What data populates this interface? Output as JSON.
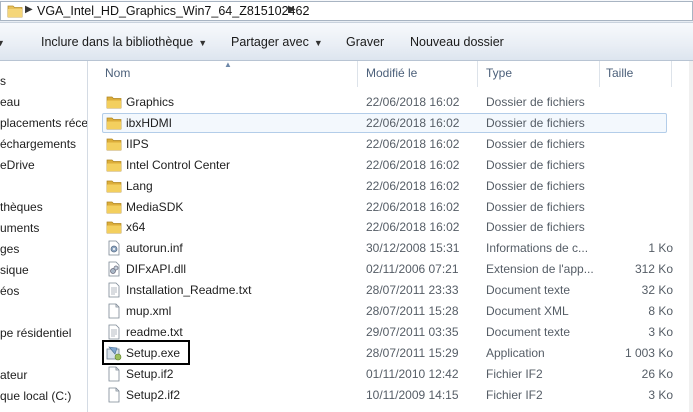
{
  "address": {
    "path_label": "VGA_Intel_HD_Graphics_Win7_64_Z815102462"
  },
  "toolbar": {
    "library_label": "Inclure dans la bibliothèque",
    "share_label": "Partager avec",
    "burn_label": "Graver",
    "new_folder_label": "Nouveau dossier"
  },
  "nav": {
    "items": [
      {
        "label": "s",
        "icon": "star-icon"
      },
      {
        "label": "eau",
        "icon": "desktop-icon"
      },
      {
        "label": "placements récen",
        "icon": "recent-icon"
      },
      {
        "label": "échargements",
        "icon": "download-icon"
      },
      {
        "label": "eDrive",
        "icon": "cloud-icon"
      },
      {
        "label": "thèques",
        "icon": "library-icon"
      },
      {
        "label": "uments",
        "icon": "documents-icon"
      },
      {
        "label": "ges",
        "icon": "images-icon"
      },
      {
        "label": "sique",
        "icon": "music-icon"
      },
      {
        "label": "éos",
        "icon": "video-icon"
      },
      {
        "label": "pe résidentiel",
        "icon": "homegroup-icon"
      },
      {
        "label": "ateur",
        "icon": "computer-icon"
      },
      {
        "label": "que local (C:)",
        "icon": "drive-icon"
      }
    ]
  },
  "columns": {
    "name": "Nom",
    "modified": "Modifié le",
    "type": "Type",
    "size": "Taille"
  },
  "files": [
    {
      "name": "Graphics",
      "date": "22/06/2018 16:02",
      "type": "Dossier de fichiers",
      "size": "",
      "icon": "folder-icon"
    },
    {
      "name": "ibxHDMI",
      "date": "22/06/2018 16:02",
      "type": "Dossier de fichiers",
      "size": "",
      "icon": "folder-icon"
    },
    {
      "name": "IIPS",
      "date": "22/06/2018 16:02",
      "type": "Dossier de fichiers",
      "size": "",
      "icon": "folder-icon"
    },
    {
      "name": "Intel Control Center",
      "date": "22/06/2018 16:02",
      "type": "Dossier de fichiers",
      "size": "",
      "icon": "folder-icon"
    },
    {
      "name": "Lang",
      "date": "22/06/2018 16:02",
      "type": "Dossier de fichiers",
      "size": "",
      "icon": "folder-icon"
    },
    {
      "name": "MediaSDK",
      "date": "22/06/2018 16:02",
      "type": "Dossier de fichiers",
      "size": "",
      "icon": "folder-icon"
    },
    {
      "name": "x64",
      "date": "22/06/2018 16:02",
      "type": "Dossier de fichiers",
      "size": "",
      "icon": "folder-icon"
    },
    {
      "name": "autorun.inf",
      "date": "30/12/2008 15:31",
      "type": "Informations de c...",
      "size": "1 Ko",
      "icon": "settings-file-icon"
    },
    {
      "name": "DIFxAPI.dll",
      "date": "02/11/2006 07:21",
      "type": "Extension de l'app...",
      "size": "312 Ko",
      "icon": "dll-file-icon"
    },
    {
      "name": "Installation_Readme.txt",
      "date": "28/07/2011 23:33",
      "type": "Document texte",
      "size": "32 Ko",
      "icon": "text-file-icon"
    },
    {
      "name": "mup.xml",
      "date": "28/07/2011 15:28",
      "type": "Document XML",
      "size": "8 Ko",
      "icon": "file-icon"
    },
    {
      "name": "readme.txt",
      "date": "29/07/2011 03:35",
      "type": "Document texte",
      "size": "3 Ko",
      "icon": "text-file-icon"
    },
    {
      "name": "Setup.exe",
      "date": "28/07/2011 15:29",
      "type": "Application",
      "size": "1 003 Ko",
      "icon": "setup-exe-icon"
    },
    {
      "name": "Setup.if2",
      "date": "01/11/2010 12:42",
      "type": "Fichier IF2",
      "size": "26 Ko",
      "icon": "file-icon"
    },
    {
      "name": "Setup2.if2",
      "date": "10/11/2009 14:15",
      "type": "Fichier IF2",
      "size": "3 Ko",
      "icon": "file-icon"
    }
  ]
}
